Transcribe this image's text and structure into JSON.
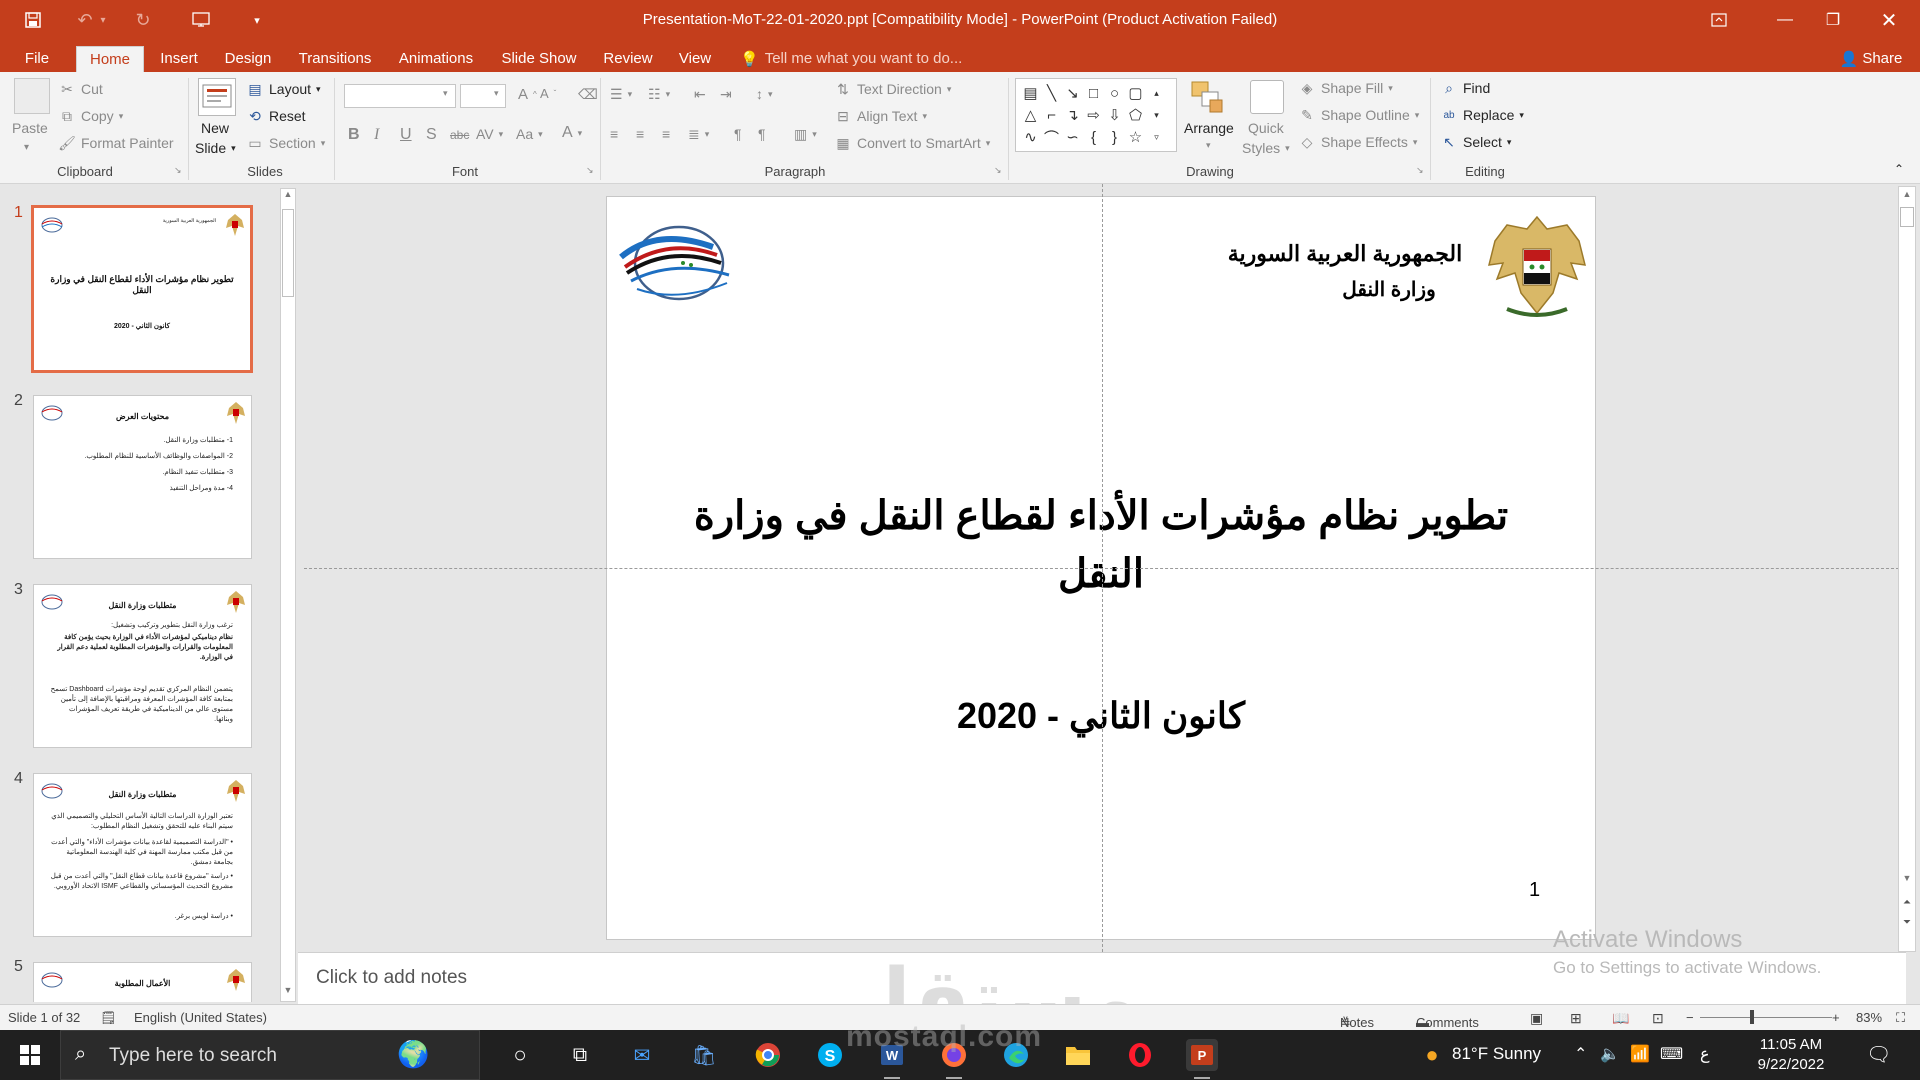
{
  "window": {
    "title": "Presentation-MoT-22-01-2020.ppt [Compatibility Mode] - PowerPoint (Product Activation Failed)",
    "share_label": "Share"
  },
  "tabs": [
    "File",
    "Home",
    "Insert",
    "Design",
    "Transitions",
    "Animations",
    "Slide Show",
    "Review",
    "View"
  ],
  "active_tab": "Home",
  "tell_me": "Tell me what you want to do...",
  "ribbon": {
    "clipboard": {
      "label": "Clipboard",
      "paste": "Paste",
      "cut": "Cut",
      "copy": "Copy",
      "format_painter": "Format Painter"
    },
    "slides": {
      "label": "Slides",
      "new_slide_1": "New",
      "new_slide_2": "Slide",
      "layout": "Layout",
      "reset": "Reset",
      "section": "Section"
    },
    "font": {
      "label": "Font"
    },
    "paragraph": {
      "label": "Paragraph",
      "text_direction": "Text Direction",
      "align_text": "Align Text",
      "convert_smartart": "Convert to SmartArt"
    },
    "drawing": {
      "label": "Drawing",
      "arrange": "Arrange",
      "quick_styles_1": "Quick",
      "quick_styles_2": "Styles",
      "shape_fill": "Shape Fill",
      "shape_outline": "Shape Outline",
      "shape_effects": "Shape Effects"
    },
    "editing": {
      "label": "Editing",
      "find": "Find",
      "replace": "Replace",
      "select": "Select"
    }
  },
  "thumbnails": [
    {
      "num": "1",
      "title": "تطوير نظام مؤشرات الأداء لقطاع النقل في وزارة النقل",
      "sub": "كانون الثاني - 2020"
    },
    {
      "num": "2",
      "title": "محتويات العرض",
      "lines": [
        "1- متطلبات وزارة النقل.",
        "2- المواصفات والوظائف الأساسية للنظام المطلوب.",
        "3- متطلبات تنفيذ النظام.",
        "4- مدة ومراحل التنفيذ"
      ]
    },
    {
      "num": "3",
      "title": "متطلبات وزارة النقل",
      "lines": [
        "ترغب وزارة النقل بتطوير وتركيب وتشغيل:",
        "نظام ديناميكي لمؤشرات الأداء في الوزارة بحيث يؤمن كافة المعلومات والقرارات والمؤشرات المطلوبة لعملية دعم القرار في الوزارة.",
        "يتضمن النظام المركزي تقديم لوحة مؤشرات Dashboard تسمح بمتابعة كافة المؤشرات المعرفة ومراقبتها بالإضافة إلى تأمين مستوى عالي من الديناميكية في طريقة تعريف المؤشرات وبنائها."
      ]
    },
    {
      "num": "4",
      "title": "متطلبات وزارة النقل",
      "lines": [
        "تعتبر الوزارة الدراسات التالية الأساس التحليلي والتصميمي الذي سيتم البناء عليه للتحقق وتشغيل النظام المطلوب:",
        "• \"الدراسة التصميمية لقاعدة بيانات مؤشرات الأداء\" والتي أعدت من قبل مكتب ممارسة المهنة في كلية الهندسة المعلوماتية بجامعة دمشق.",
        "• دراسة \"مشروع قاعدة بيانات قطاع النقل\" والتي أعدت من قبل مشروع التحديث المؤسساتي والقطاعي ISMF الاتحاد الأوروبي.",
        "• دراسة لويس برغر."
      ]
    },
    {
      "num": "5",
      "title": "الأعمال المطلوبة"
    }
  ],
  "slide": {
    "header_1": "الجمهورية العربية السورية",
    "header_2": "وزارة النقل",
    "title_line_1": "تطوير نظام مؤشرات الأداء لقطاع النقل في وزارة",
    "title_line_2": "النقل",
    "subtitle": "كانون الثاني - 2020",
    "page_number": "1"
  },
  "notes_placeholder": "Click to add notes",
  "status": {
    "slide_count": "Slide 1 of 32",
    "language": "English (United States)",
    "notes": "Notes",
    "comments": "Comments",
    "zoom": "83%"
  },
  "activation": {
    "line1": "Activate Windows",
    "line2": "Go to Settings to activate Windows."
  },
  "watermark": {
    "arabic": "مستقل",
    "latin": "mostaql.com"
  },
  "taskbar": {
    "search": "Type here to search",
    "weather": "81°F  Sunny",
    "lang": "ع",
    "time": "11:05 AM",
    "date": "9/22/2022"
  },
  "colors": {
    "accent": "#c43e1c",
    "selected_thumb": "#e46c47"
  }
}
